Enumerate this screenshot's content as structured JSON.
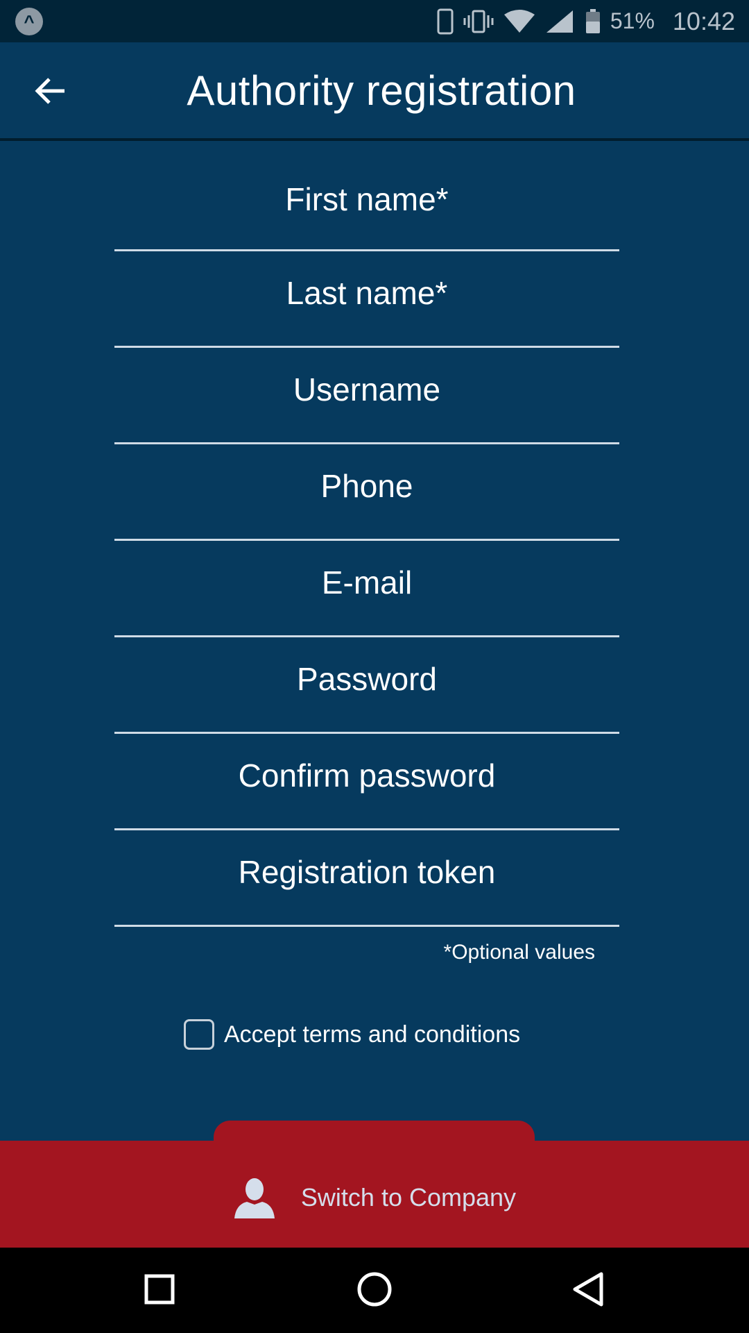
{
  "status_bar": {
    "battery": "51%",
    "time": "10:42"
  },
  "app_bar": {
    "title": "Authority registration"
  },
  "form": {
    "fields": [
      {
        "placeholder": "First name*",
        "value": ""
      },
      {
        "placeholder": "Last name*",
        "value": ""
      },
      {
        "placeholder": "Username",
        "value": ""
      },
      {
        "placeholder": "Phone",
        "value": ""
      },
      {
        "placeholder": "E-mail",
        "value": ""
      },
      {
        "placeholder": "Password",
        "value": ""
      },
      {
        "placeholder": "Confirm password",
        "value": ""
      },
      {
        "placeholder": "Registration token",
        "value": ""
      }
    ],
    "optional_note": "*Optional values",
    "terms_label": "Accept terms and conditions",
    "terms_checked": false
  },
  "switch": {
    "label": "Switch to Company",
    "icon": "person-icon"
  },
  "colors": {
    "background": "#063a5e",
    "status_bar": "#012438",
    "accent_red": "#a31520"
  }
}
